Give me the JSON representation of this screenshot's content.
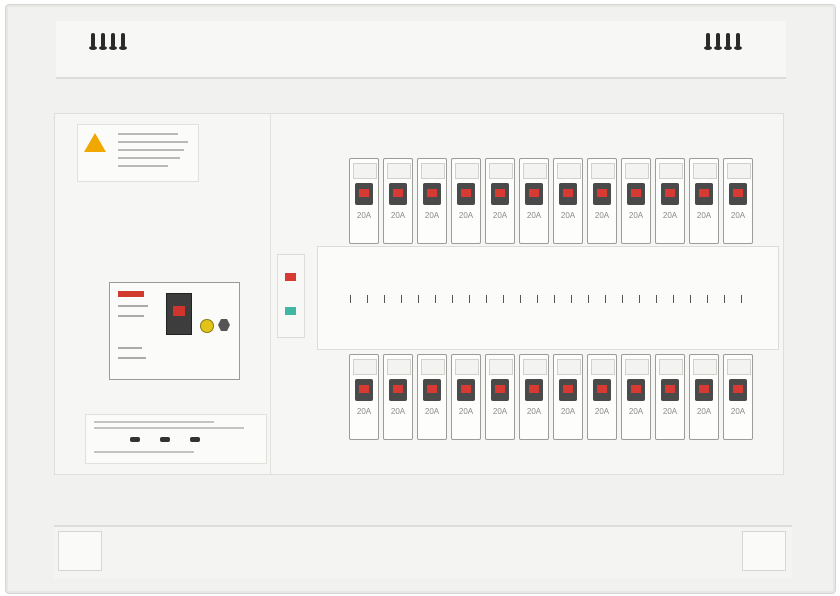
{
  "image": {
    "subject": "distribution-panel",
    "colors": {
      "panel": "#f1f1ef",
      "breaker_window": "#4a4a4a",
      "indicator_red": "#d63a32",
      "warning_yellow": "#f0a800",
      "test_button_yellow": "#e3c21a",
      "indicator_teal": "#3fb7a3"
    }
  },
  "branch_breakers": {
    "top_row": {
      "count": 12,
      "rating_label": "20A"
    },
    "bottom_row": {
      "count": 12,
      "rating_label": "20A"
    }
  },
  "icons": [
    "warning-triangle-icon",
    "vent-slot-icon",
    "test-button-icon",
    "reset-button-icon"
  ]
}
